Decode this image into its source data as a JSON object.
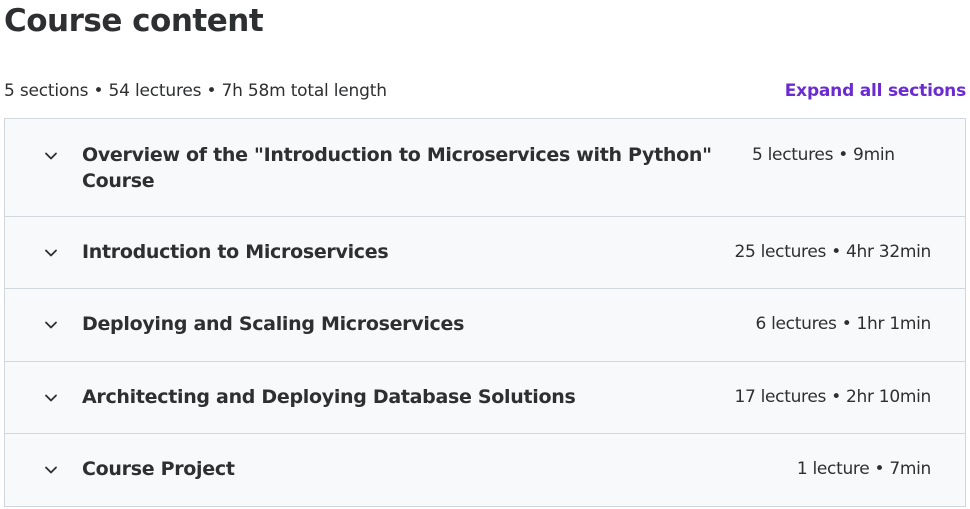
{
  "header": {
    "title": "Course content",
    "summary": "5 sections • 54 lectures • 7h 58m total length",
    "expand_label": "Expand all sections"
  },
  "sections": [
    {
      "title": "Overview of the \"Introduction to Microservices with Python\" Course",
      "meta": "5 lectures • 9min",
      "icon": "chevron-down-icon"
    },
    {
      "title": "Introduction to Microservices",
      "meta": "25 lectures • 4hr 32min",
      "icon": "chevron-down-icon"
    },
    {
      "title": "Deploying and Scaling Microservices",
      "meta": "6 lectures • 1hr 1min",
      "icon": "chevron-down-icon"
    },
    {
      "title": "Architecting and Deploying Database Solutions",
      "meta": "17 lectures • 2hr 10min",
      "icon": "chevron-down-icon"
    },
    {
      "title": "Course Project",
      "meta": "1 lecture • 7min",
      "icon": "chevron-down-icon"
    }
  ],
  "colors": {
    "accent": "#6a2bd2",
    "text": "#2d2f31",
    "panel_bg": "#f7f9fa",
    "border": "#d1d7dc"
  }
}
